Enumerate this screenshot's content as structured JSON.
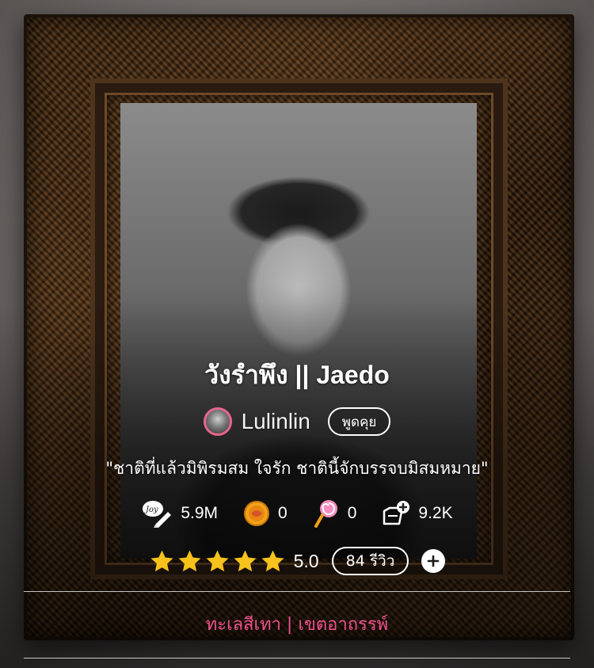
{
  "story": {
    "title": "วังรำพึง || Jaedo",
    "tagline": "\"ชาติที่แล้วมิพิรมสม ใจรัก ชาตินี้จักบรรจบมิสมหมาย\"",
    "category": "ทะเลสีเทา | เขตอาถรรพ์"
  },
  "author": {
    "name": "Lulinlin",
    "chat_label": "พูดคุย"
  },
  "stats": {
    "views": "5.9M",
    "coins": "0",
    "candy": "0",
    "saves": "9.2K"
  },
  "rating": {
    "stars": 5,
    "value": "5.0",
    "reviews_label": "84 รีวิว"
  },
  "colors": {
    "accent_pink": "#f0508e",
    "star_yellow": "#f6c21b"
  },
  "icons": {
    "views": "joy-pen-icon",
    "coins": "coin-icon",
    "candy": "lollipop-icon",
    "saves": "library-add-icon",
    "add": "plus-circle-icon"
  }
}
